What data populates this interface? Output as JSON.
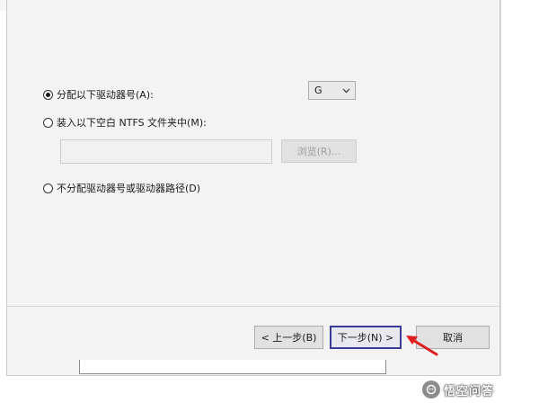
{
  "dialog": {
    "options": {
      "assign_letter": {
        "label": "分配以下驱动器号(A):",
        "selected": true
      },
      "mount_folder": {
        "label": "装入以下空白 NTFS 文件夹中(M):",
        "selected": false
      },
      "no_assign": {
        "label": "不分配驱动器号或驱动器路径(D)",
        "selected": false
      }
    },
    "drive_letter": {
      "value": "G",
      "icon": "chevron-down-icon"
    },
    "folder_path": {
      "value": "",
      "placeholder": ""
    },
    "browse_label": "浏览(R)..."
  },
  "footer": {
    "prev_label": "< 上一步(B)",
    "next_label": "下一步(N) >",
    "cancel_label": "取消"
  },
  "annotation": {
    "arrow_color": "#e02020",
    "icon": "arrow-icon"
  },
  "watermark": {
    "text": "悟空问答",
    "icon": "wukong-logo-icon"
  },
  "colors": {
    "dialog_bg": "#f3f3f3",
    "button_bg": "#e1e1e1",
    "focus_border": "#3a3a9a",
    "disabled_text": "#9d9d9d"
  }
}
